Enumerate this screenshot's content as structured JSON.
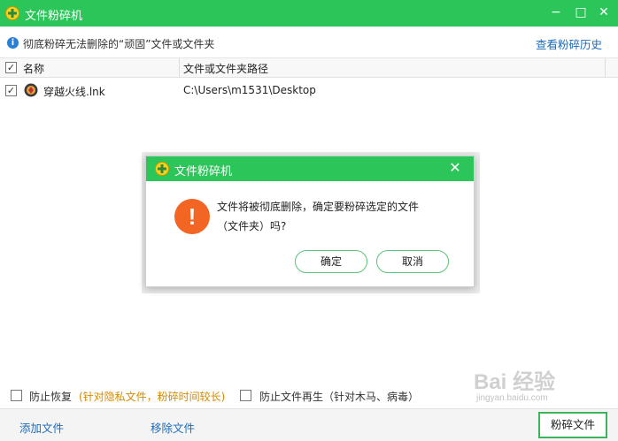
{
  "window": {
    "title": "文件粉碎机",
    "minimize_glyph": "−",
    "maximize_glyph": "□",
    "close_glyph": "✕",
    "accent_color": "#2cc55a"
  },
  "infobar": {
    "icon": "info-icon",
    "icon_glyph": "i",
    "text": "彻底粉碎无法删除的“顽固”文件或文件夹",
    "history_link": "查看粉碎历史"
  },
  "table": {
    "header_checked": "✓",
    "columns": [
      "名称",
      "文件或文件夹路径"
    ],
    "rows": [
      {
        "checked": "✓",
        "name": "穿越火线.lnk",
        "path": "C:\\Users\\m1531\\Desktop"
      }
    ]
  },
  "dialog": {
    "title": "文件粉碎机",
    "close_glyph": "✕",
    "warn_glyph": "!",
    "message_line1": "文件将被彻底删除，确定要粉碎选定的文件",
    "message_line2": "（文件夹）吗?",
    "confirm": "确定",
    "cancel": "取消",
    "warn_color": "#f26522"
  },
  "options": {
    "prevent_recovery": "防止恢复",
    "prevent_recovery_note": "(针对隐私文件，粉碎时间较长)",
    "prevent_regen": "防止文件再生（针对木马、病毒）"
  },
  "bottom": {
    "add_file": "添加文件",
    "remove_file": "移除文件",
    "shred": "粉碎文件"
  },
  "watermark": {
    "text": "Bai 经验",
    "url": "jingyan.baidu.com"
  }
}
